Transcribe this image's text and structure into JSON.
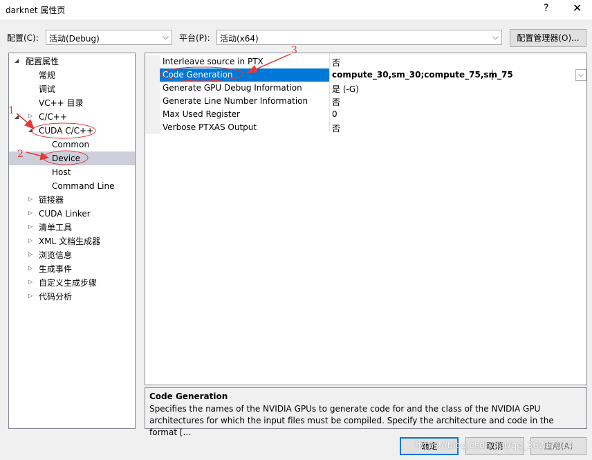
{
  "window": {
    "title": "darknet 属性页",
    "help_label": "?",
    "close_label": "✕"
  },
  "toolbar": {
    "config_label": "配置(C):",
    "config_value": "活动(Debug)",
    "platform_label": "平台(P):",
    "platform_value": "活动(x64)",
    "config_manager_label": "配置管理器(O)..."
  },
  "tree": {
    "root": "配置属性",
    "items": {
      "general": "常规",
      "debugging": "调试",
      "vcpp_dirs": "VC++ 目录",
      "cpp": "C/C++",
      "cuda_cpp": "CUDA C/C++",
      "common": "Common",
      "device": "Device",
      "host": "Host",
      "command_line": "Command Line",
      "linker": "链接器",
      "cuda_linker": "CUDA Linker",
      "manifest_tool": "清单工具",
      "xml_doc": "XML 文档生成器",
      "browse_info": "浏览信息",
      "build_events": "生成事件",
      "custom_build": "自定义生成步骤",
      "code_analysis": "代码分析"
    }
  },
  "properties": [
    {
      "name": "Interleave source in PTX",
      "value": "否"
    },
    {
      "name": "Code Generation",
      "value": "compute_30,sm_30;compute_75,sm_75"
    },
    {
      "name": "Generate GPU Debug Information",
      "value": "是 (-G)"
    },
    {
      "name": "Generate Line Number Information",
      "value": "否"
    },
    {
      "name": "Max Used Register",
      "value": "0"
    },
    {
      "name": "Verbose PTXAS Output",
      "value": "否"
    }
  ],
  "description": {
    "title": "Code Generation",
    "text": "Specifies the names of the NVIDIA GPUs to generate code for and the class of the NVIDIA GPU architectures for which the input files must be compiled.  Specify the architecture and code in the format [..."
  },
  "buttons": {
    "ok": "确定",
    "cancel": "取消",
    "apply": "应用(A)"
  },
  "annotations": {
    "one": "1",
    "two": "2",
    "three": "3",
    "color": "#e53935"
  },
  "watermark": "https://blog.csdn.net/qq_36217014",
  "colors": {
    "selection": "#0078d7",
    "tree_selection": "#cccedb"
  }
}
